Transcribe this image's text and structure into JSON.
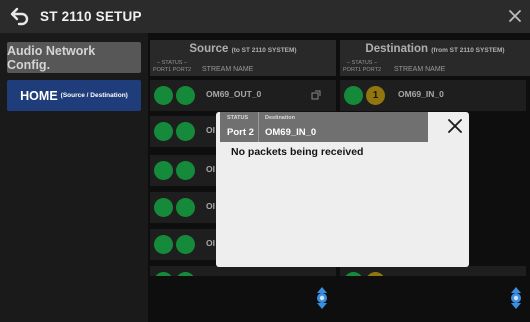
{
  "window": {
    "title": "ST 2110 SETUP"
  },
  "nav": {
    "audio_label": "Audio Network Config.",
    "home_label": "HOME",
    "home_sub": "(Source / Destination)"
  },
  "source": {
    "title": "Source",
    "sub": "(to ST 2110 SYSTEM)",
    "status_label": "– STATUS –",
    "port_labels": "PORT1  PORT2",
    "stream_label": "STREAM NAME",
    "rows": [
      {
        "name": "OM69_OUT_0"
      },
      {
        "name": "OI"
      },
      {
        "name": "OI"
      },
      {
        "name": "OI"
      },
      {
        "name": "OI"
      }
    ]
  },
  "destination": {
    "title": "Destination",
    "sub": "(from ST 2110 SYSTEM)",
    "status_label": "– STATUS –",
    "port_labels": "PORT1  PORT2",
    "stream_label": "STREAM NAME",
    "rows": [
      {
        "name": "OM69_IN_0",
        "warn": "1"
      }
    ]
  },
  "popup": {
    "status_key": "STATUS",
    "dest_key": "Destination",
    "status_value": "Port 2",
    "dest_value": "OM69_IN_0",
    "message": "No packets being received"
  },
  "colors": {
    "status_ok": "#1fc053",
    "status_warn": "#c9a316",
    "home_active": "#1f3d7a",
    "scroll_knob": "#3b8fe0"
  }
}
